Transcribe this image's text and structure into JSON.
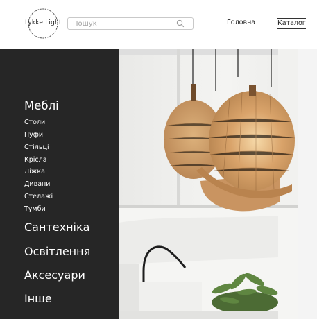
{
  "brand": {
    "logo_text": "Lykke Light"
  },
  "search": {
    "placeholder": "Пошук",
    "icon": "search-icon"
  },
  "nav": {
    "home": "Головна",
    "catalog": "Каталог"
  },
  "sidebar": {
    "main_category": "Меблі",
    "subitems": [
      "Столи",
      "Пуфи",
      "Стільці",
      "Крісла",
      "Ліжка",
      "Дивани",
      "Стелажі",
      "Тумби"
    ],
    "categories": [
      "Сантехніка",
      "Освітлення",
      "Аксесуари",
      "Інше"
    ]
  },
  "colors": {
    "sidebar_bg": "#262626",
    "text_light": "#ffffff",
    "accent_wood": "#c89863"
  }
}
